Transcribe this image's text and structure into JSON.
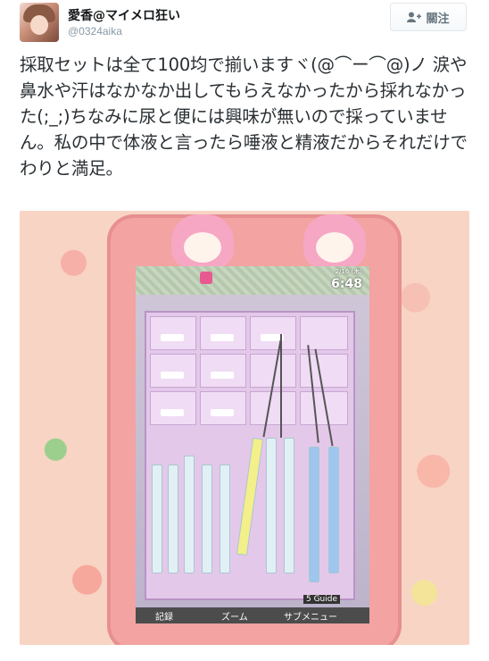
{
  "header": {
    "display_name": "愛香@マイメロ狂い",
    "handle": "@0324aika",
    "follow_label": "關注",
    "follow_icon": "add-person-icon"
  },
  "tweet": {
    "text": "採取セットは全て100均で揃いますヾ(@⌒ー⌒@)ノ 涙や鼻水や汗はなかなか出してもらえなかったから採れなかった(;_;)ちなみに尿と便には興味が無いので採っていません。私の中で体液と言ったら唾液と精液だからそれだけでわりと満足。"
  },
  "photo": {
    "phone_screen": {
      "date": "2/16 (木)",
      "clock": "6:48",
      "guide_label": "5 Guide",
      "softkeys": [
        "記録",
        "ズーム",
        "サブメニュー"
      ]
    }
  }
}
